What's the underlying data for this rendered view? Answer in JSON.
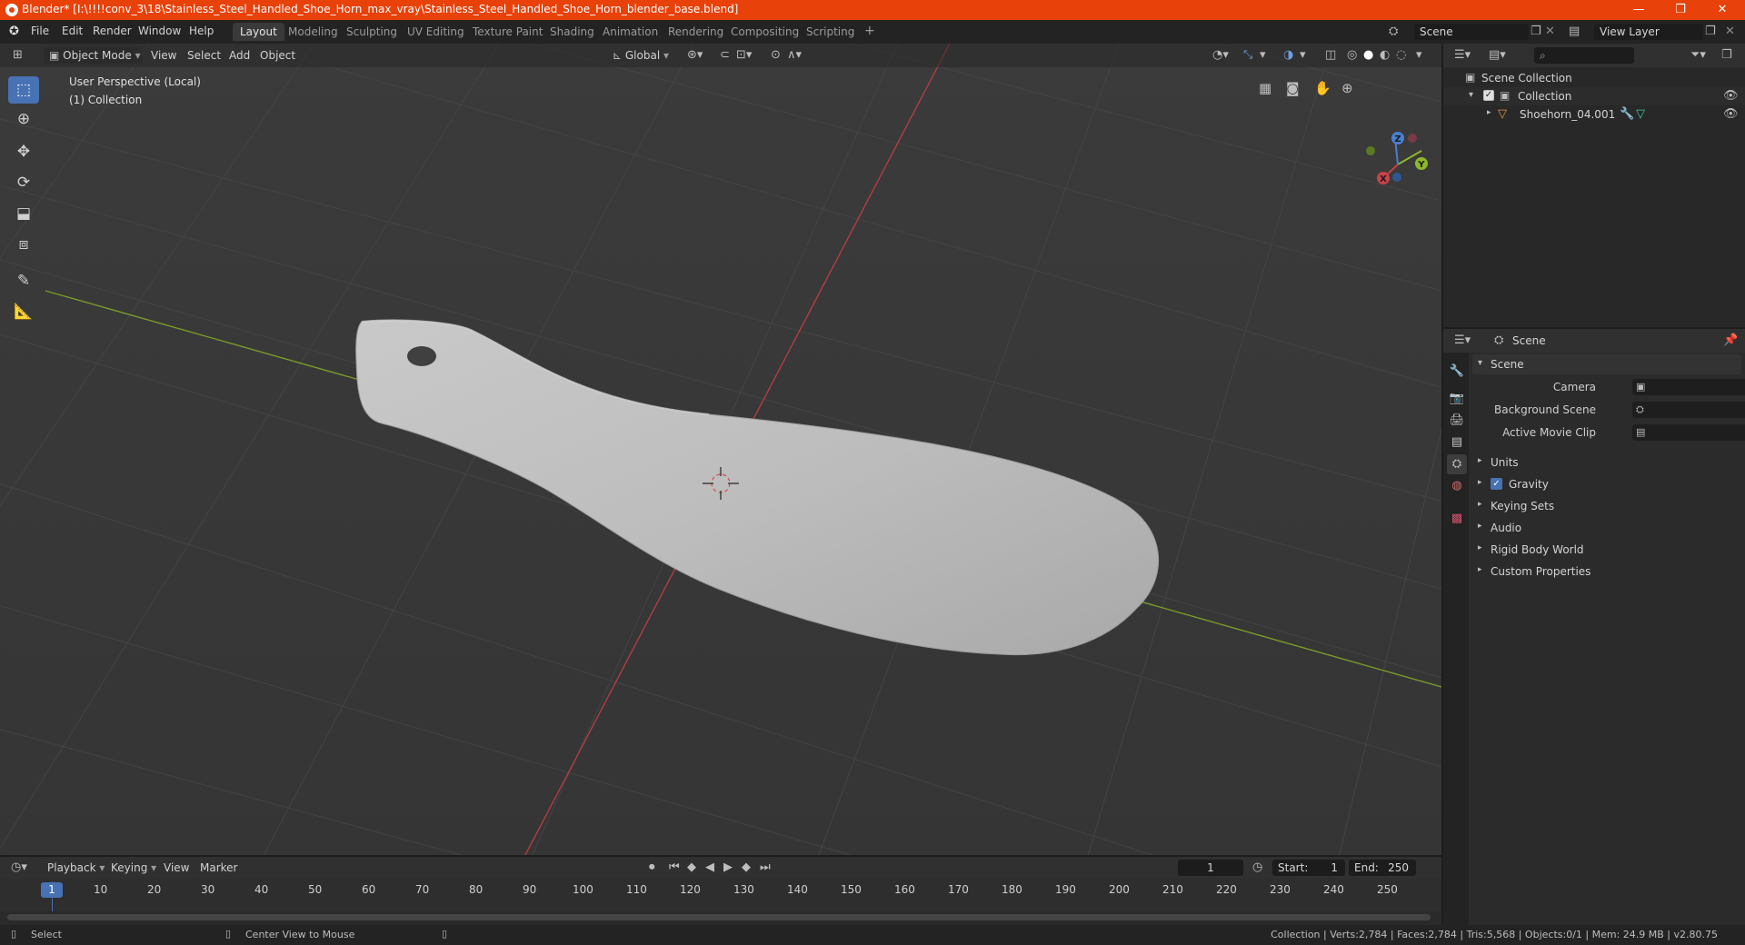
{
  "window": {
    "title": "Blender* [I:\\!!!!conv_3\\18\\Stainless_Steel_Handled_Shoe_Horn_max_vray\\Stainless_Steel_Handled_Shoe_Horn_blender_base.blend]",
    "minimize": "—",
    "maximize": "❐",
    "close": "✕"
  },
  "menu": [
    "File",
    "Edit",
    "Render",
    "Window",
    "Help"
  ],
  "workspaces": [
    "Layout",
    "Modeling",
    "Sculpting",
    "UV Editing",
    "Texture Paint",
    "Shading",
    "Animation",
    "Rendering",
    "Compositing",
    "Scripting"
  ],
  "workspace_add": "+",
  "scene_name": "Scene",
  "view_layer": "View Layer",
  "viewport": {
    "mode": "Object Mode",
    "menus": [
      "View",
      "Select",
      "Add",
      "Object"
    ],
    "orientation": "Global",
    "perspective_label": "User Perspective (Local)",
    "collection_label": "(1) Collection",
    "gizmo": {
      "x": "X",
      "y": "Y",
      "z": "Z"
    }
  },
  "outliner": {
    "root": "Scene Collection",
    "collection": "Collection",
    "object": "Shoehorn_04.001"
  },
  "properties": {
    "context": "Scene",
    "panel_title": "Scene",
    "fields": [
      {
        "label": "Camera"
      },
      {
        "label": "Background Scene"
      },
      {
        "label": "Active Movie Clip"
      }
    ],
    "sections": [
      "Units",
      "Gravity",
      "Keying Sets",
      "Audio",
      "Rigid Body World",
      "Custom Properties"
    ]
  },
  "timeline": {
    "menus": [
      "Playback",
      "Keying",
      "View",
      "Marker"
    ],
    "current_frame": "1",
    "start_label": "Start:",
    "start": "1",
    "end_label": "End:",
    "end": "250",
    "ruler": [
      "1",
      "10",
      "20",
      "30",
      "40",
      "50",
      "60",
      "70",
      "80",
      "90",
      "100",
      "110",
      "120",
      "130",
      "140",
      "150",
      "160",
      "170",
      "180",
      "190",
      "200",
      "210",
      "220",
      "230",
      "240",
      "250"
    ]
  },
  "status": {
    "left": "Select",
    "middle": "Center View to Mouse",
    "right": "Collection | Verts:2,784 | Faces:2,784 | Tris:5,568 | Objects:0/1 | Mem: 24.9 MB | v2.80.75"
  },
  "colors": {
    "titlebar": "#e8410a",
    "accent": "#4772b3",
    "viewport_bg": "#393939",
    "x_axis": "#c9424a",
    "y_axis": "#8cb82a"
  }
}
